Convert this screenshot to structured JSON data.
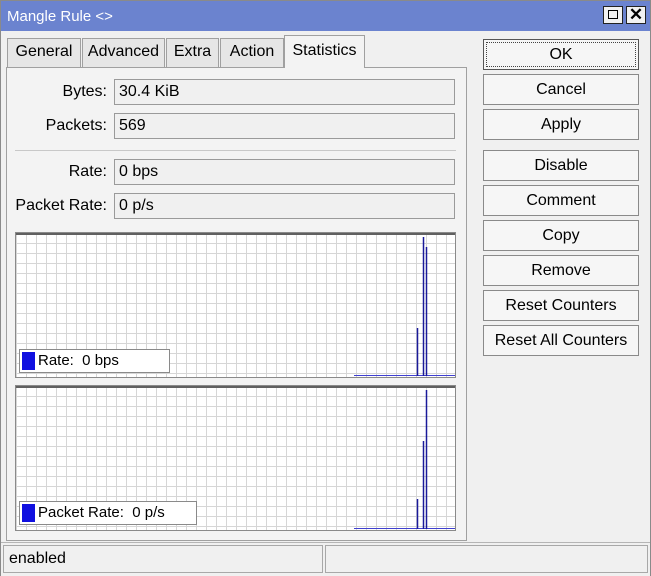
{
  "window": {
    "title": "Mangle Rule <>"
  },
  "tabs": [
    {
      "label": "General",
      "active": false
    },
    {
      "label": "Advanced",
      "active": false
    },
    {
      "label": "Extra",
      "active": false
    },
    {
      "label": "Action",
      "active": false
    },
    {
      "label": "Statistics",
      "active": true
    }
  ],
  "stats": {
    "bytes": {
      "label": "Bytes:",
      "value": "30.4 KiB"
    },
    "packets": {
      "label": "Packets:",
      "value": "569"
    },
    "rate": {
      "label": "Rate:",
      "value": "0 bps"
    },
    "packet_rate": {
      "label": "Packet Rate:",
      "value": "0 p/s"
    }
  },
  "graphs": {
    "rate": {
      "legend": "Rate:  0 bps",
      "color": "#1010e0"
    },
    "packet_rate": {
      "legend": "Packet Rate:  0 p/s",
      "color": "#1010e0"
    }
  },
  "buttons": {
    "ok": "OK",
    "cancel": "Cancel",
    "apply": "Apply",
    "disable": "Disable",
    "comment": "Comment",
    "copy": "Copy",
    "remove": "Remove",
    "reset_counters": "Reset Counters",
    "reset_all_counters": "Reset All Counters"
  },
  "status": {
    "state": "enabled",
    "secondary": ""
  }
}
